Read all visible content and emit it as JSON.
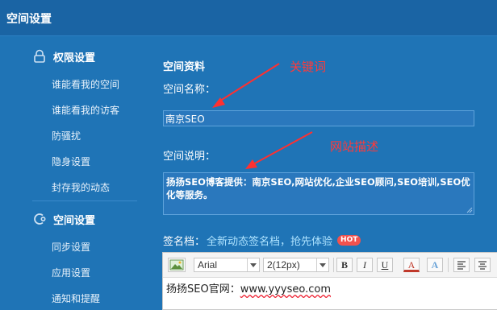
{
  "header": {
    "title": "空间设置"
  },
  "sidebar": {
    "sections": [
      {
        "label": "权限设置",
        "icon": "lock-icon",
        "items": [
          "谁能看我的空间",
          "谁能看我的访客",
          "防骚扰",
          "隐身设置",
          "封存我的动态"
        ]
      },
      {
        "label": "空间设置",
        "icon": "space-settings-icon",
        "items": [
          "同步设置",
          "应用设置",
          "通知和提醒"
        ]
      }
    ]
  },
  "main": {
    "heading": "空间资料",
    "name_label": "空间名称：",
    "name_value": "南京SEO",
    "desc_label": "空间说明：",
    "desc_value": "扬扬SEO博客提供：南京SEO,网站优化,企业SEO顾问,SEO培训,SEO优化等服务。",
    "annotations": {
      "keyword": "关键词",
      "description": "网站描述"
    },
    "signature": {
      "label": "签名档：",
      "link": "全新动态签名档，抢先体验",
      "badge": "HOT"
    },
    "editor": {
      "font": "Arial",
      "size": "2(12px)",
      "buttons": {
        "bold": "B",
        "italic": "I",
        "underline": "U",
        "color": "A",
        "highlight": "A"
      },
      "content_prefix": "扬扬SEO官网：",
      "content_url": "www.yyyseo.com"
    }
  },
  "colors": {
    "background": "#1f74b6",
    "header": "#1a64a4",
    "annotation": "#ff3a3a",
    "link": "#aee3ff",
    "hot": "#f2524e"
  }
}
